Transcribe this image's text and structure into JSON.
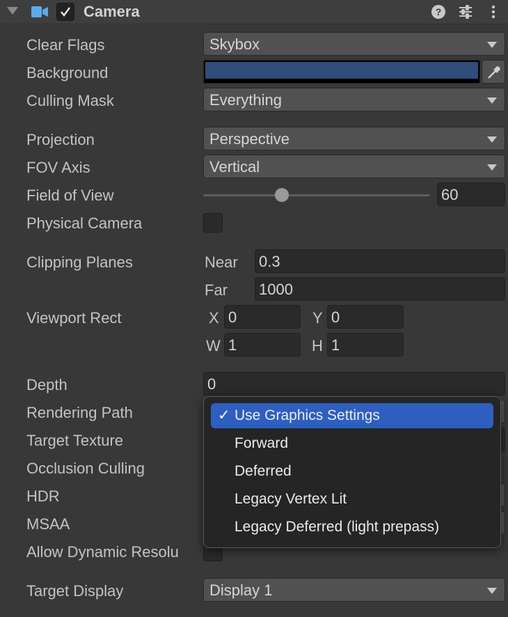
{
  "header": {
    "title": "Camera",
    "enabled_checkmark": "✓",
    "icons": [
      "foldout-arrow",
      "camera-icon",
      "help-icon",
      "presets-icon",
      "more-icon"
    ]
  },
  "fields": {
    "clear_flags": {
      "label": "Clear Flags",
      "value": "Skybox"
    },
    "background": {
      "label": "Background",
      "color": "#314d79"
    },
    "culling_mask": {
      "label": "Culling Mask",
      "value": "Everything"
    },
    "projection": {
      "label": "Projection",
      "value": "Perspective"
    },
    "fov_axis": {
      "label": "FOV Axis",
      "value": "Vertical"
    },
    "field_of_view": {
      "label": "Field of View",
      "value": "60",
      "slider_fraction": 0.57
    },
    "physical_camera": {
      "label": "Physical Camera",
      "checked": false
    },
    "clipping_planes": {
      "label": "Clipping Planes",
      "near_label": "Near",
      "near": "0.3",
      "far_label": "Far",
      "far": "1000"
    },
    "viewport_rect": {
      "label": "Viewport Rect",
      "x_label": "X",
      "x": "0",
      "y_label": "Y",
      "y": "0",
      "w_label": "W",
      "w": "1",
      "h_label": "H",
      "h": "1"
    },
    "depth": {
      "label": "Depth",
      "value": "0"
    },
    "rendering_path": {
      "label": "Rendering Path"
    },
    "target_texture": {
      "label": "Target Texture"
    },
    "occlusion_culling": {
      "label": "Occlusion Culling"
    },
    "hdr": {
      "label": "HDR"
    },
    "msaa": {
      "label": "MSAA"
    },
    "allow_dynamic_resolution": {
      "label": "Allow Dynamic Resolu"
    },
    "target_display": {
      "label": "Target Display",
      "value": "Display 1"
    }
  },
  "rendering_path_menu": {
    "selected_mark": "✓",
    "options": [
      "Use Graphics Settings",
      "Forward",
      "Deferred",
      "Legacy Vertex Lit",
      "Legacy Deferred (light prepass)"
    ],
    "selected_index": 0
  },
  "colors": {
    "accent": "#2e5fc0",
    "panel": "#383838",
    "field": "#2a2a2a"
  }
}
